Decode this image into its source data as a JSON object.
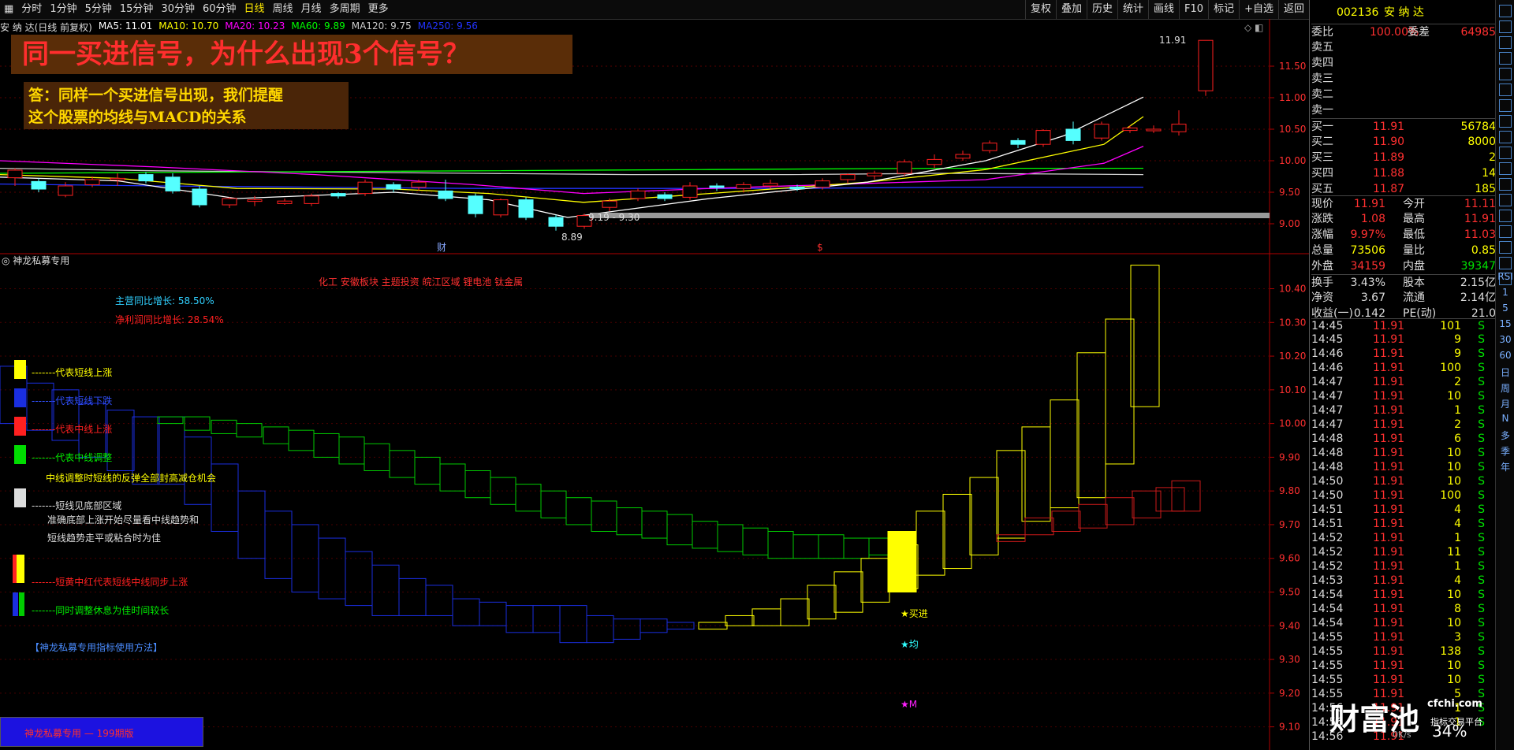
{
  "toolbar": {
    "tabs": [
      {
        "label": "分时"
      },
      {
        "label": "1分钟"
      },
      {
        "label": "5分钟"
      },
      {
        "label": "15分钟"
      },
      {
        "label": "30分钟"
      },
      {
        "label": "60分钟"
      },
      {
        "label": "日线"
      },
      {
        "label": "周线"
      },
      {
        "label": "月线"
      },
      {
        "label": "多周期"
      },
      {
        "label": "更多"
      }
    ],
    "active_index": 6,
    "right_menu": [
      {
        "label": "复权"
      },
      {
        "label": "叠加"
      },
      {
        "label": "历史"
      },
      {
        "label": "统计"
      },
      {
        "label": "画线"
      },
      {
        "label": "F10"
      },
      {
        "label": "标记"
      },
      {
        "label": "+自选"
      },
      {
        "label": "返回"
      }
    ]
  },
  "chart_header": {
    "stock_label": "安 纳 达(日线 前复权)",
    "ma_legend": [
      {
        "text": "MA5: 11.01",
        "color": "#ffffff"
      },
      {
        "text": "MA10: 10.70",
        "color": "#ffff00"
      },
      {
        "text": "MA20: 10.23",
        "color": "#ff00ff"
      },
      {
        "text": "MA60: 9.89",
        "color": "#00ff00"
      },
      {
        "text": "MA120: 9.75",
        "color": "#cccccc"
      },
      {
        "text": "MA250: 9.56",
        "color": "#2233ff"
      }
    ]
  },
  "banner": {
    "question": "同一买进信号，为什么出现3个信号？",
    "answer_line1": "答：同样一个买进信号出现，我们提醒",
    "answer_line2": "这个股票的均线与MACD的关系"
  },
  "chart_annotations": {
    "high_label": "11.91",
    "low_label": "8.89",
    "range_label": "9.19 - 9.30",
    "marker_cai": "财",
    "marker_s": "$"
  },
  "price_axis_main": [
    "11.50",
    "11.00",
    "10.50",
    "10.00",
    "9.50",
    "9.00"
  ],
  "indicator": {
    "title": "神龙私募专用",
    "sectors": "化工 安徽板块 主题投资 皖江区域 锂电池 钛金属",
    "revenue_growth": "主营同比增长:  58.50%",
    "profit_growth": "净利润同比增长:  28.54%",
    "legend": [
      {
        "text": "-------代表短线上涨",
        "color": "#ffff00",
        "swatch": "#ffff00"
      },
      {
        "text": "-------代表短线下跌",
        "color": "#3050ff",
        "swatch": "#1a2ee0"
      },
      {
        "text": "-------代表中线上涨",
        "color": "#ff2020",
        "swatch": "#ff2020"
      },
      {
        "text": "-------代表中线调整",
        "color": "#00ee00",
        "swatch": "#00dd00"
      }
    ],
    "note1": "中线调整时短线的反弹全部封高减仓机会",
    "bottom_zone": "-------短线见底部区域",
    "note2": "准确底部上涨开始尽量看中线趋势和",
    "note3": "短线趋势走平或粘合时为佳",
    "sync_up": "-------短黄中红代表短线中线同步上涨",
    "sync_rest": "-------同时调整休息为佳时间较长",
    "usage_link": "【神龙私募专用指标使用方法】",
    "signal_buy": "★买进",
    "signal_jun": "★均",
    "signal_m": "★M",
    "bottom_box": "神龙私募专用 — 199期版",
    "axis": [
      "10.40",
      "10.30",
      "10.20",
      "10.10",
      "10.00",
      "9.90",
      "9.80",
      "9.70",
      "9.60",
      "9.50",
      "9.40",
      "9.30",
      "9.20",
      "9.10"
    ]
  },
  "quote": {
    "code": "002136",
    "name": "安 纳 达",
    "weibi": {
      "label": "委比",
      "value": "100.00%",
      "label2": "委差",
      "value2": "64985"
    },
    "sell": [
      {
        "label": "卖五",
        "price": "",
        "vol": ""
      },
      {
        "label": "卖四",
        "price": "",
        "vol": ""
      },
      {
        "label": "卖三",
        "price": "",
        "vol": ""
      },
      {
        "label": "卖二",
        "price": "",
        "vol": ""
      },
      {
        "label": "卖一",
        "price": "",
        "vol": ""
      }
    ],
    "buy": [
      {
        "label": "买一",
        "price": "11.91",
        "vol": "56784"
      },
      {
        "label": "买二",
        "price": "11.90",
        "vol": "8000"
      },
      {
        "label": "买三",
        "price": "11.89",
        "vol": "2"
      },
      {
        "label": "买四",
        "price": "11.88",
        "vol": "14"
      },
      {
        "label": "买五",
        "price": "11.87",
        "vol": "185"
      }
    ],
    "stats": [
      {
        "l1": "现价",
        "v1": "11.91",
        "c1": "#ff3030",
        "l2": "今开",
        "v2": "11.11",
        "c2": "#ff3030"
      },
      {
        "l1": "涨跌",
        "v1": "1.08",
        "c1": "#ff3030",
        "l2": "最高",
        "v2": "11.91",
        "c2": "#ff3030"
      },
      {
        "l1": "涨幅",
        "v1": "9.97%",
        "c1": "#ff3030",
        "l2": "最低",
        "v2": "11.03",
        "c2": "#ff3030"
      },
      {
        "l1": "总量",
        "v1": "73506",
        "c1": "#ffff00",
        "l2": "量比",
        "v2": "0.85",
        "c2": "#ffff00"
      },
      {
        "l1": "外盘",
        "v1": "34159",
        "c1": "#ff3030",
        "l2": "内盘",
        "v2": "39347",
        "c2": "#00e000"
      },
      {
        "l1": "换手",
        "v1": "3.43%",
        "c1": "#dddddd",
        "l2": "股本",
        "v2": "2.15亿",
        "c2": "#dddddd"
      },
      {
        "l1": "净资",
        "v1": "3.67",
        "c1": "#dddddd",
        "l2": "流通",
        "v2": "2.14亿",
        "c2": "#dddddd"
      },
      {
        "l1": "收益(一)",
        "v1": "0.142",
        "c1": "#dddddd",
        "l2": "PE(动)",
        "v2": "21.0",
        "c2": "#dddddd"
      }
    ],
    "ticks": [
      {
        "t": "14:45",
        "p": "11.91",
        "v": "101",
        "s": "S"
      },
      {
        "t": "14:45",
        "p": "11.91",
        "v": "9",
        "s": "S"
      },
      {
        "t": "14:46",
        "p": "11.91",
        "v": "9",
        "s": "S"
      },
      {
        "t": "14:46",
        "p": "11.91",
        "v": "100",
        "s": "S"
      },
      {
        "t": "14:47",
        "p": "11.91",
        "v": "2",
        "s": "S"
      },
      {
        "t": "14:47",
        "p": "11.91",
        "v": "10",
        "s": "S"
      },
      {
        "t": "14:47",
        "p": "11.91",
        "v": "1",
        "s": "S"
      },
      {
        "t": "14:47",
        "p": "11.91",
        "v": "2",
        "s": "S"
      },
      {
        "t": "14:48",
        "p": "11.91",
        "v": "6",
        "s": "S"
      },
      {
        "t": "14:48",
        "p": "11.91",
        "v": "10",
        "s": "S"
      },
      {
        "t": "14:48",
        "p": "11.91",
        "v": "10",
        "s": "S"
      },
      {
        "t": "14:50",
        "p": "11.91",
        "v": "10",
        "s": "S"
      },
      {
        "t": "14:50",
        "p": "11.91",
        "v": "100",
        "s": "S"
      },
      {
        "t": "14:51",
        "p": "11.91",
        "v": "4",
        "s": "S"
      },
      {
        "t": "14:51",
        "p": "11.91",
        "v": "4",
        "s": "S"
      },
      {
        "t": "14:52",
        "p": "11.91",
        "v": "1",
        "s": "S"
      },
      {
        "t": "14:52",
        "p": "11.91",
        "v": "11",
        "s": "S"
      },
      {
        "t": "14:52",
        "p": "11.91",
        "v": "1",
        "s": "S"
      },
      {
        "t": "14:53",
        "p": "11.91",
        "v": "4",
        "s": "S"
      },
      {
        "t": "14:54",
        "p": "11.91",
        "v": "10",
        "s": "S"
      },
      {
        "t": "14:54",
        "p": "11.91",
        "v": "8",
        "s": "S"
      },
      {
        "t": "14:54",
        "p": "11.91",
        "v": "10",
        "s": "S"
      },
      {
        "t": "14:55",
        "p": "11.91",
        "v": "3",
        "s": "S"
      },
      {
        "t": "14:55",
        "p": "11.91",
        "v": "138",
        "s": "S"
      },
      {
        "t": "14:55",
        "p": "11.91",
        "v": "10",
        "s": "S"
      },
      {
        "t": "14:55",
        "p": "11.91",
        "v": "10",
        "s": "S"
      },
      {
        "t": "14:55",
        "p": "11.91",
        "v": "5",
        "s": "S"
      },
      {
        "t": "14:56",
        "p": "11.91",
        "v": "1",
        "s": "S"
      },
      {
        "t": "14:56",
        "p": "11.91",
        "v": "1",
        "s": "S"
      },
      {
        "t": "14:56",
        "p": "11.91",
        "v": "",
        "s": ""
      }
    ]
  },
  "toolcolumn": {
    "labels": [
      "RSI",
      "1",
      "5",
      "15",
      "30",
      "60",
      "日",
      "周",
      "月",
      "N",
      "多",
      "季",
      "年"
    ]
  },
  "watermark": {
    "brand": "财富池",
    "site": "cfchi.com",
    "slogan": "指标交易平台",
    "speed": "0K/s",
    "percent": "34%"
  },
  "colors": {
    "up": "#ff2020",
    "down": "#55ffff",
    "short_up": "#ffff00",
    "short_down": "#1a2ee0",
    "mid_up": "#cc1a1a",
    "mid_down": "#00cc00"
  }
}
